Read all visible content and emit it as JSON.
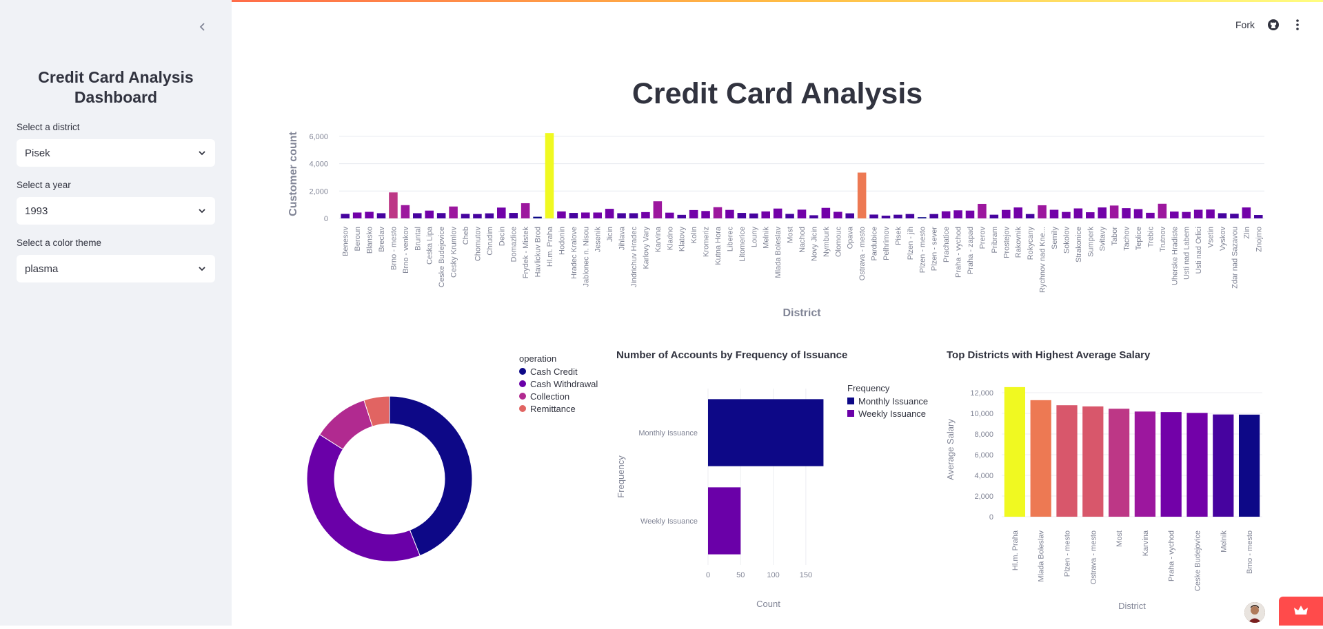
{
  "sidebar": {
    "title": "Credit Card Analysis Dashboard",
    "district_label": "Select a district",
    "district_value": "Pisek",
    "year_label": "Select a year",
    "year_value": "1993",
    "theme_label": "Select a color theme",
    "theme_value": "plasma"
  },
  "header": {
    "fork_label": "Fork"
  },
  "page_title": "Credit Card Analysis",
  "colors": {
    "accent": "#ff4b4b",
    "sidebar_bg": "#f0f2f6"
  },
  "chart_data": [
    {
      "type": "bar",
      "xlabel": "District",
      "ylabel": "Customer count",
      "ylim": [
        0,
        6500
      ],
      "yticks": [
        "0",
        "2,000",
        "4,000",
        "6,000"
      ],
      "grid": true,
      "categories": [
        "Benesov",
        "Beroun",
        "Blansko",
        "Breclav",
        "Brno - mesto",
        "Brno - venkov",
        "Bruntal",
        "Ceska Lipa",
        "Ceske Budejovice",
        "Cesky Krumlov",
        "Cheb",
        "Chomutov",
        "Chrudim",
        "Decin",
        "Domazlice",
        "Frydek - Mistek",
        "Havlickuv Brod",
        "Hl.m. Praha",
        "Hodonin",
        "Hradec Kralove",
        "Jablonec n. Nisou",
        "Jesenik",
        "Jicin",
        "Jihlava",
        "Jindrichuv Hradec",
        "Karlovy Vary",
        "Karvina",
        "Kladno",
        "Klatovy",
        "Kolin",
        "Kromeriz",
        "Kutna Hora",
        "Liberec",
        "Litomerice",
        "Louny",
        "Melnik",
        "Mlada Boleslav",
        "Most",
        "Nachod",
        "Novy Jicin",
        "Nymburk",
        "Olomouc",
        "Opava",
        "Ostrava - mesto",
        "Pardubice",
        "Pelhrimov",
        "Pisek",
        "Plzen - jih",
        "Plzen - mesto",
        "Plzen - sever",
        "Prachatice",
        "Praha - vychod",
        "Praha - zapad",
        "Prerov",
        "Pribram",
        "Prostejov",
        "Rakovnik",
        "Rokycany",
        "Rychnov nad Kne...",
        "Semily",
        "Sokolov",
        "Strakonice",
        "Sumperk",
        "Svitavy",
        "Tabor",
        "Tachov",
        "Teplice",
        "Trebic",
        "Trutnov",
        "Uherske Hradiste",
        "Usti nad Labem",
        "Usti nad Orlici",
        "Vsetin",
        "Vyskov",
        "Zdar nad Sazavou",
        "Zlin",
        "Znojmo"
      ],
      "values": [
        330,
        430,
        480,
        380,
        1900,
        970,
        380,
        570,
        390,
        870,
        330,
        320,
        370,
        790,
        400,
        1110,
        120,
        6240,
        510,
        400,
        430,
        430,
        700,
        380,
        380,
        460,
        1250,
        420,
        260,
        610,
        540,
        820,
        620,
        400,
        360,
        510,
        720,
        330,
        640,
        230,
        770,
        480,
        370,
        3350,
        280,
        200,
        270,
        320,
        90,
        320,
        520,
        590,
        570,
        1060,
        270,
        620,
        800,
        320,
        960,
        630,
        470,
        730,
        450,
        800,
        940,
        750,
        680,
        410,
        1070,
        500,
        470,
        630,
        650,
        380,
        340,
        800,
        250
      ]
    },
    {
      "type": "pie",
      "donut": true,
      "legend_title": "operation",
      "labels": [
        "Cash Credit",
        "Cash Withdrawal",
        "Collection",
        "Remittance"
      ],
      "values": [
        44,
        40,
        11,
        5
      ],
      "colors": [
        "#0d0887",
        "#6a00a8",
        "#b12a90",
        "#e16462"
      ]
    },
    {
      "type": "bar",
      "orientation": "horizontal",
      "title": "Number of Accounts by Frequency of Issuance",
      "xlabel": "Count",
      "ylabel": "Frequency",
      "legend_title": "Frequency",
      "categories": [
        "Monthly Issuance",
        "Weekly Issuance"
      ],
      "values": [
        177,
        50
      ],
      "xticks": [
        0,
        50,
        100,
        150
      ],
      "xlim": [
        0,
        185
      ],
      "colors": [
        "#0d0887",
        "#6a00a8"
      ]
    },
    {
      "type": "bar",
      "title": "Top Districts with Highest Average Salary",
      "xlabel": "District",
      "ylabel": "Average Salary",
      "ylim": [
        0,
        13000
      ],
      "yticks": [
        "0",
        "2,000",
        "4,000",
        "6,000",
        "8,000",
        "10,000",
        "12,000"
      ],
      "categories": [
        "Hl.m. Praha",
        "Mlada Boleslav",
        "Plzen - mesto",
        "Ostrava - mesto",
        "Most",
        "Karvina",
        "Praha - vychod",
        "Ceske Budejovice",
        "Melnik",
        "Brno - mesto"
      ],
      "values": [
        12541,
        11277,
        10787,
        10673,
        10446,
        10177,
        10124,
        10045,
        9893,
        9878
      ]
    }
  ]
}
